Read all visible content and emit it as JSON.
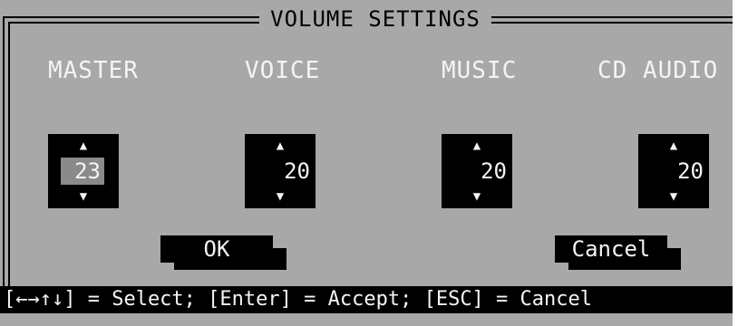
{
  "dialog": {
    "title": "VOLUME SETTINGS"
  },
  "channels": [
    {
      "label": "MASTER",
      "value": "23",
      "selected": true
    },
    {
      "label": "VOICE",
      "value": "20",
      "selected": false
    },
    {
      "label": "MUSIC",
      "value": "20",
      "selected": false
    },
    {
      "label": "CD AUDIO",
      "value": "20",
      "selected": false
    }
  ],
  "icons": {
    "up": "▲",
    "down": "▼"
  },
  "buttons": {
    "ok_label": "OK",
    "cancel_label": "Cancel"
  },
  "status_bar": {
    "text": "[←→↑↓] = Select; [Enter] = Accept; [ESC] = Cancel"
  },
  "colors": {
    "background": "#a8a8a8",
    "text_light": "#f4f4f4",
    "dark": "#000000",
    "selected_value_bg": "#8a8a8a"
  }
}
